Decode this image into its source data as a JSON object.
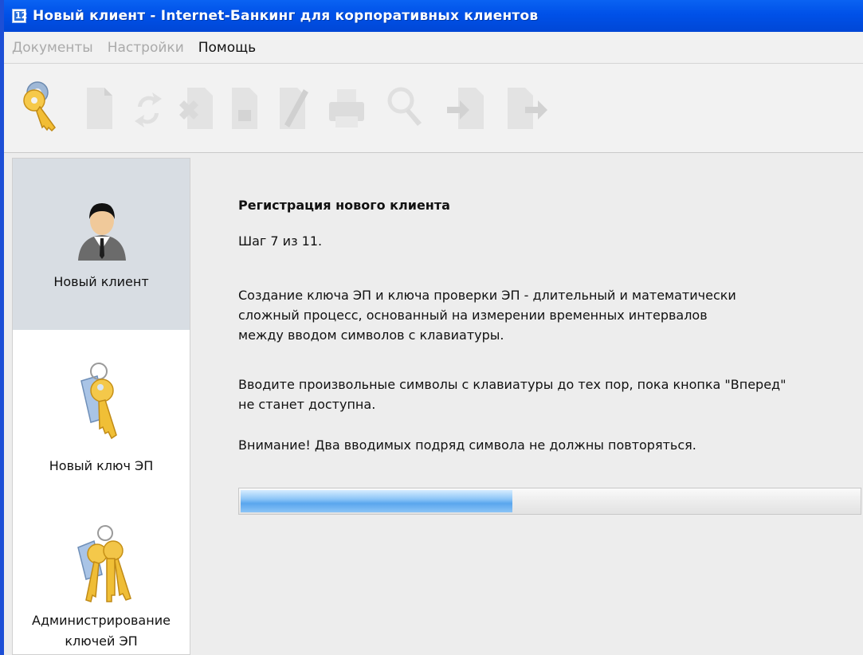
{
  "window": {
    "title": "Новый клиент - Internet-Банкинг для корпоративных клиентов",
    "icon": "app-logo-icon",
    "icon_label": "12"
  },
  "menu": {
    "items": [
      {
        "label": "Документы",
        "enabled": false
      },
      {
        "label": "Настройки",
        "enabled": false
      },
      {
        "label": "Помощь",
        "enabled": true
      }
    ]
  },
  "toolbar": {
    "buttons": [
      {
        "icon": "key-icon",
        "enabled": true
      },
      {
        "icon": "new-document-icon",
        "enabled": false
      },
      {
        "icon": "refresh-icon",
        "enabled": false
      },
      {
        "icon": "delete-document-icon",
        "enabled": false
      },
      {
        "icon": "save-document-icon",
        "enabled": false
      },
      {
        "icon": "edit-document-icon",
        "enabled": false
      },
      {
        "icon": "print-icon",
        "enabled": false
      },
      {
        "icon": "search-icon",
        "enabled": false
      },
      {
        "icon": "import-icon",
        "enabled": false
      },
      {
        "icon": "export-icon",
        "enabled": false
      }
    ]
  },
  "sidebar": {
    "items": [
      {
        "label": "Новый клиент",
        "icon": "user-icon",
        "selected": true
      },
      {
        "label": "Новый ключ ЭП",
        "icon": "key-icon",
        "selected": false
      },
      {
        "label_line1": "Администрирование",
        "label_line2": "ключей ЭП",
        "icon": "keys-bunch-icon",
        "selected": false
      }
    ]
  },
  "main": {
    "heading": "Регистрация нового клиента",
    "step": "Шаг 7 из 11.",
    "para1_line1": "Создание ключа ЭП и ключа проверки ЭП - длительный и математически",
    "para1_line2": "сложный процесс, основанный на измерении временных интервалов",
    "para1_line3": "между вводом символов с клавиатуры.",
    "para2_line1": "Вводите произвольные символы с клавиатуры до тех пор, пока кнопка \"Вперед\"",
    "para2_line2": "не станет доступна.",
    "warning": "Внимание! Два вводимых подряд символа не должны повторяться.",
    "progress": 0.44
  },
  "colors": {
    "titlebar": "#0055e5",
    "selected_sidebar": "#d8dde3",
    "progress_fill": "#5aa6ee"
  }
}
